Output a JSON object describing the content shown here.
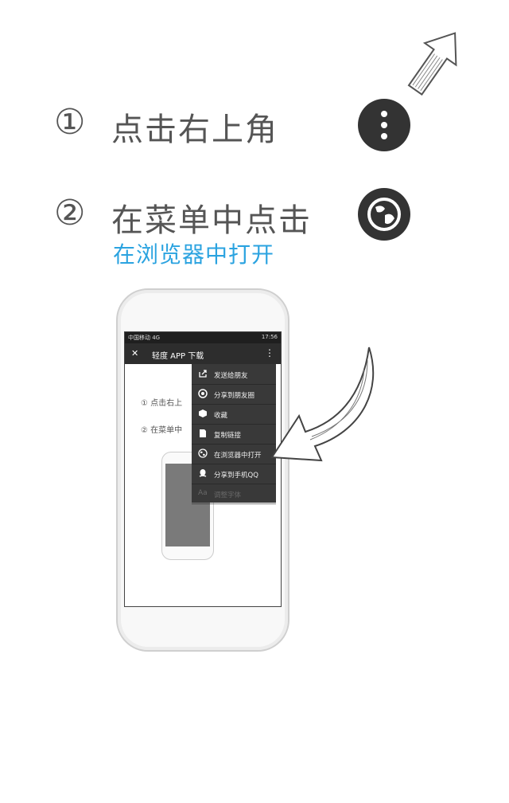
{
  "steps": [
    {
      "num": "①",
      "text": "点击右上角"
    },
    {
      "num": "②",
      "text": "在菜单中点击",
      "sub": "在浏览器中打开"
    }
  ],
  "phone": {
    "status_left": "中国移动 4G",
    "status_right": "17:56",
    "title": "轻度 APP 下载",
    "close_glyph": "✕",
    "more_glyph": "⋮",
    "content": [
      "① 点击右上",
      "② 在菜单中"
    ],
    "menu": [
      {
        "label": "发送给朋友",
        "icon": "share-icon"
      },
      {
        "label": "分享到朋友圈",
        "icon": "moments-icon"
      },
      {
        "label": "收藏",
        "icon": "cube-icon"
      },
      {
        "label": "复制链接",
        "icon": "document-icon"
      },
      {
        "label": "在浏览器中打开",
        "icon": "globe-icon"
      },
      {
        "label": "分享到手机QQ",
        "icon": "qq-penguin-icon"
      },
      {
        "label": "调整字体",
        "icon": "font-icon"
      }
    ],
    "font_prefix": "Aa"
  }
}
